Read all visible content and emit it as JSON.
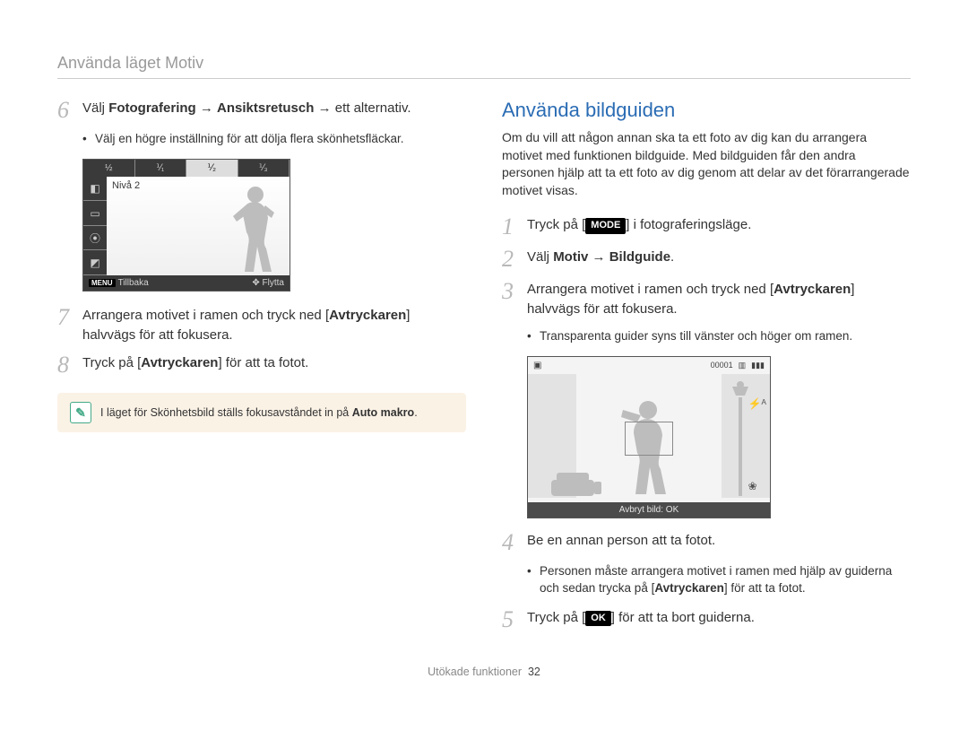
{
  "header": {
    "title": "Använda läget Motiv"
  },
  "left": {
    "step6": {
      "text_pre": "Välj ",
      "bold1": "Fotografering",
      "arrow1": " → ",
      "bold2": "Ansiktsretusch",
      "text_post": " → ett alternativ."
    },
    "step6_bullet": "Välj en högre inställning för att dölja flera skönhetsfläckar.",
    "screen1": {
      "fractions": [
        "½",
        "⅟₁",
        "⅟₂",
        "⅟₃"
      ],
      "level": "Nivå 2",
      "bottom_left": "Tillbaka",
      "bottom_right": "Flytta",
      "menu_label": "MENU"
    },
    "step7": {
      "text_pre": "Arrangera motivet i ramen och tryck ned [",
      "bold": "Avtryckaren",
      "text_post": "] halvvägs för att fokusera."
    },
    "step8": {
      "text_pre": "Tryck på [",
      "bold": "Avtryckaren",
      "text_post": "] för att ta fotot."
    },
    "note": {
      "text_pre": "I läget för Skönhetsbild ställs fokusavståndet in på ",
      "bold": "Auto makro",
      "text_post": "."
    }
  },
  "right": {
    "heading": "Använda bildguiden",
    "intro": "Om du vill att någon annan ska ta ett foto av dig kan du arrangera motivet med funktionen bildguide. Med bildguiden får den andra personen hjälp att ta ett foto av dig genom att delar av det förarrangerade motivet visas.",
    "step1": {
      "text_pre": "Tryck på [",
      "mode_label": "MODE",
      "text_post": "] i fotograferingsläge."
    },
    "step2": {
      "text_pre": "Välj ",
      "bold1": "Motiv",
      "arrow": " → ",
      "bold2": "Bildguide",
      "text_post": "."
    },
    "step3": {
      "text_pre": "Arrangera motivet i ramen och tryck ned [",
      "bold": "Avtryckaren",
      "text_post": "] halvvägs för att fokusera."
    },
    "step3_bullet": "Transparenta guider syns till vänster och höger om ramen.",
    "screen2": {
      "counter": "00001",
      "bar": "Avbryt bild: OK"
    },
    "step4": {
      "text": "Be en annan person att ta fotot."
    },
    "step4_bullet": {
      "text_pre": "Personen måste arrangera motivet i ramen med hjälp av guiderna och sedan trycka på [",
      "bold": "Avtryckaren",
      "text_post": "] för att ta fotot."
    },
    "step5": {
      "text_pre": "Tryck på [",
      "ok_label": "OK",
      "text_post": "] för att ta bort guiderna."
    }
  },
  "footer": {
    "section": "Utökade funktioner",
    "page": "32"
  }
}
